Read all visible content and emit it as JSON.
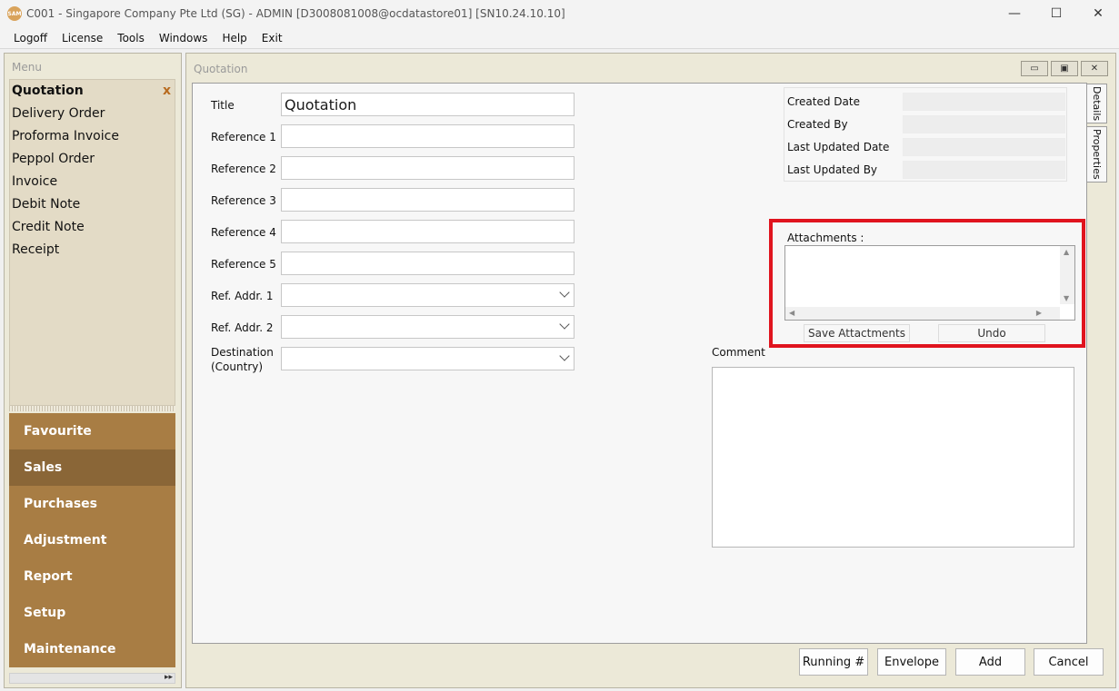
{
  "window": {
    "logo_text": "SAM",
    "title": "C001 - Singapore Company Pte Ltd (SG) - ADMIN [D3008081008@ocdatastore01] [SN10.24.10.10]",
    "minimize": "—",
    "maximize": "☐",
    "close": "✕"
  },
  "menubar": {
    "items": [
      "Logoff",
      "License",
      "Tools",
      "Windows",
      "Help",
      "Exit"
    ]
  },
  "left_panel": {
    "header": "Menu",
    "nav_items": [
      "Quotation",
      "Delivery Order",
      "Proforma Invoice",
      "Peppol Order",
      "Invoice",
      "Debit Note",
      "Credit Note",
      "Receipt"
    ],
    "active_nav_close": "x",
    "categories": [
      "Favourite",
      "Sales",
      "Purchases",
      "Adjustment",
      "Report",
      "Setup",
      "Maintenance"
    ],
    "active_category": "Sales"
  },
  "main": {
    "header": "Quotation",
    "side_tabs": [
      "Details",
      "Properties"
    ],
    "form": {
      "title_label": "Title",
      "title_value": "Quotation",
      "reference_labels": [
        "Reference 1",
        "Reference 2",
        "Reference 3",
        "Reference 4",
        "Reference 5"
      ],
      "ref_addr1_label": "Ref. Addr. 1",
      "ref_addr2_label": "Ref. Addr. 2",
      "destination_label_line1": "Destination",
      "destination_label_line2": "(Country)"
    },
    "meta": {
      "created_date": "Created Date",
      "created_by": "Created By",
      "last_updated_date": "Last Updated Date",
      "last_updated_by": "Last Updated By"
    },
    "attachments": {
      "label": "Attachments :",
      "save_button": "Save Attactments",
      "undo_button": "Undo"
    },
    "comment_label": "Comment",
    "bottom_buttons": {
      "running": "Running #",
      "envelope": "Envelope",
      "add": "Add",
      "cancel": "Cancel"
    }
  },
  "colors": {
    "accent_highlight": "#e0141e",
    "category_bg": "#a87d44",
    "category_active": "#8a6637"
  }
}
